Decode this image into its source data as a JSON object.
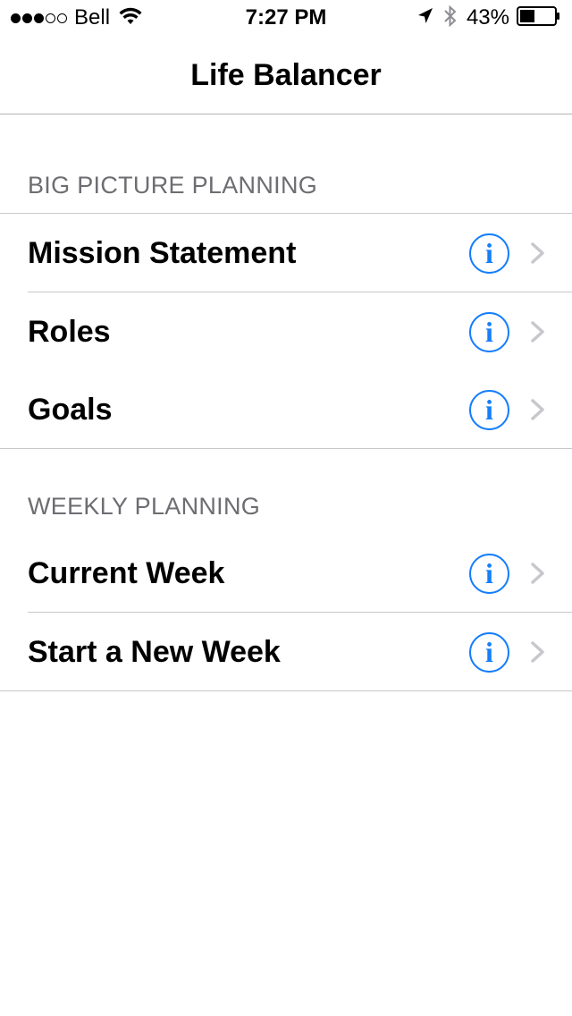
{
  "status_bar": {
    "carrier": "Bell",
    "time": "7:27 PM",
    "battery_percent": "43%",
    "battery_level": 0.43,
    "signal_bars_filled": 3,
    "signal_bars_total": 5
  },
  "nav": {
    "title": "Life Balancer"
  },
  "colors": {
    "accent": "#157efb",
    "separator": "#c8c7cc",
    "section_text": "#6d6d72",
    "chevron": "#c7c7cc"
  },
  "sections": [
    {
      "header": "BIG PICTURE PLANNING",
      "rows": [
        {
          "label": "Mission Statement",
          "info_icon": "info-icon",
          "accessory": "chevron-right-icon"
        },
        {
          "label": "Roles",
          "info_icon": "info-icon",
          "accessory": "chevron-right-icon"
        },
        {
          "label": "Goals",
          "info_icon": "info-icon",
          "accessory": "chevron-right-icon"
        }
      ]
    },
    {
      "header": "WEEKLY PLANNING",
      "rows": [
        {
          "label": "Current Week",
          "info_icon": "info-icon",
          "accessory": "chevron-right-icon"
        },
        {
          "label": "Start a New Week",
          "info_icon": "info-icon",
          "accessory": "chevron-right-icon"
        }
      ]
    }
  ]
}
